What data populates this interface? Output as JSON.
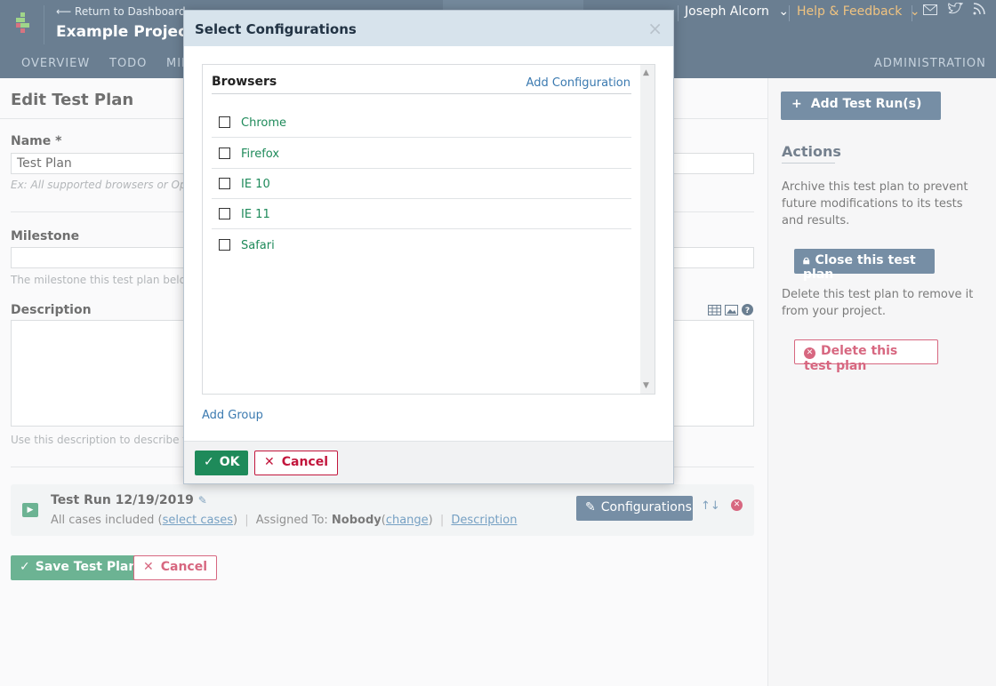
{
  "header": {
    "return_link": "⟵ Return to Dashboard",
    "project_title": "Example Project",
    "user_name": "Joseph Alcorn",
    "help_link": "Help & Feedback",
    "chevron": "⌄"
  },
  "nav": {
    "items": [
      "OVERVIEW",
      "TODO",
      "MIL"
    ],
    "administration": "ADMINISTRATION"
  },
  "form": {
    "page_title": "Edit Test Plan",
    "name_label": "Name *",
    "name_value": "Test Plan",
    "name_hint": "Ex: All supported browsers or Opera",
    "milestone_label": "Milestone",
    "milestone_hint": "The milestone this test plan belong",
    "description_label": "Description",
    "description_hint": "Use this description to describe the"
  },
  "test_run": {
    "title": "Test Run 12/19/2019",
    "included_prefix": "All cases included (",
    "select_cases": "select cases",
    "included_suffix": ")",
    "assigned_label": "Assigned To:",
    "assigned_value": "Nobody",
    "change_link": "change",
    "description_link": "Description",
    "configurations_button": "Configurations",
    "reorder_icon": "↑↓"
  },
  "bottom_buttons": {
    "save": "Save Test Plan",
    "cancel": "Cancel"
  },
  "sidebar": {
    "add_runs": "Add Test Run(s)",
    "actions_title": "Actions",
    "archive_text": "Archive this test plan to prevent future modifications to its tests and results.",
    "close_button": "Close this test plan",
    "delete_text": "Delete this test plan to remove it from your project.",
    "delete_button": "Delete this test plan"
  },
  "modal": {
    "title": "Select Configurations",
    "close": "×",
    "group_name": "Browsers",
    "add_configuration": "Add Configuration",
    "configs": [
      "Chrome",
      "Firefox",
      "IE 10",
      "IE 11",
      "Safari"
    ],
    "add_group": "Add Group",
    "ok": "OK",
    "cancel": "Cancel"
  },
  "colors": {
    "header_bg": "#1b3a57",
    "green": "#1e8a5a",
    "red": "#c2163c",
    "link_blue": "#3b7ab0",
    "dark_button": "#2d5275",
    "help_orange": "#e8a33d"
  }
}
